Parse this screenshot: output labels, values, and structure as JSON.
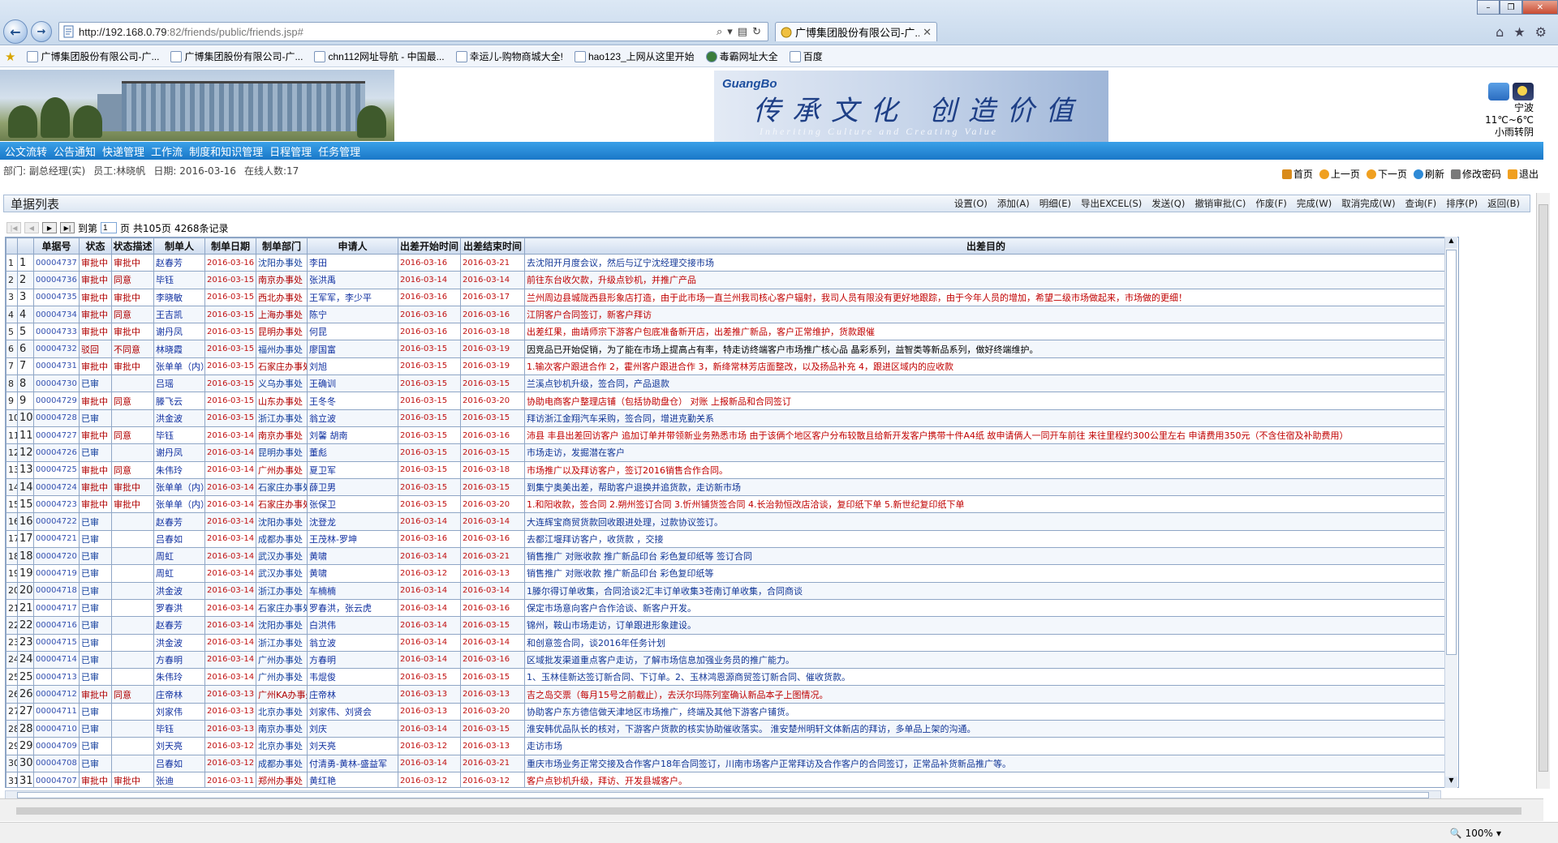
{
  "browser": {
    "url_main": "http://192.168.0.79",
    "url_rest": ":82/friends/public/friends.jsp#",
    "tab_title": "广博集团股份有限公司-广...",
    "favorites": [
      "广博集团股份有限公司-广...",
      "广博集团股份有限公司-广...",
      "chn112网址导航 - 中国最...",
      "幸运儿-购物商城大全!",
      "hao123_上网从这里开始",
      "毒霸网址大全",
      "百度"
    ],
    "zoom": "100%"
  },
  "banner": {
    "logo_brand": "GuangBo",
    "slogan": "传承文化 创造价值",
    "slogan_en": "Inheriting Culture and Creating Value",
    "weather_city": "宁波",
    "weather_temp": "11℃~6℃",
    "weather_desc": "小雨转阴"
  },
  "menu": [
    "公文流转",
    "公告通知",
    "快递管理",
    "工作流",
    "制度和知识管理",
    "日程管理",
    "任务管理"
  ],
  "info": {
    "dept_label": "部门:",
    "dept": "副总经理(实)",
    "staff_label": "员工:",
    "staff": "林晓帆",
    "date_label": "日期:",
    "date": "2016-03-16",
    "online_label": "在线人数:",
    "online": "17"
  },
  "topnav": [
    "首页",
    "上一页",
    "下一页",
    "刷新",
    "修改密码",
    "退出"
  ],
  "list": {
    "title": "单据列表",
    "actions": [
      "设置(O)",
      "添加(A)",
      "明细(E)",
      "导出EXCEL(S)",
      "发送(Q)",
      "撤销审批(C)",
      "作废(F)",
      "完成(W)",
      "取消完成(W)",
      "查询(F)",
      "排序(P)",
      "返回(B)"
    ],
    "pager": {
      "goto_label": "到第",
      "page_value": "1",
      "page_suffix": "页",
      "total": "共105页",
      "count": "4268条记录"
    },
    "headers": [
      "",
      "",
      "单据号",
      "状态",
      "状态描述",
      "制单人",
      "制单日期",
      "制单部门",
      "申请人",
      "出差开始时间",
      "出差结束时间",
      "出差目的"
    ],
    "rows": [
      [
        "1",
        "1",
        "00004737",
        "审批中",
        "审批中",
        "赵春芳",
        "2016-03-16",
        "沈阳办事处",
        "李田",
        "2016-03-16",
        "2016-03-21",
        "去沈阳开月度会议，然后与辽宁沈经理交接市场",
        "blue"
      ],
      [
        "2",
        "2",
        "00004736",
        "审批中",
        "同意",
        "毕钰",
        "2016-03-15",
        "南京办事处",
        "张洪禹",
        "2016-03-14",
        "2016-03-14",
        "前往东台收欠款，升级点钞机，并推广产品",
        "red"
      ],
      [
        "3",
        "3",
        "00004735",
        "审批中",
        "审批中",
        "李晓敏",
        "2016-03-15",
        "西北办事处",
        "王军军，李少平",
        "2016-03-16",
        "2016-03-17",
        "兰州周边县城陇西县形象店打造，由于此市场一直兰州我司核心客户辐射，我司人员有限没有更好地跟踪，由于今年人员的增加，希望二级市场做起来，市场做的更细！",
        "red"
      ],
      [
        "4",
        "4",
        "00004734",
        "审批中",
        "同意",
        "王吉凯",
        "2016-03-15",
        "上海办事处",
        "陈宁",
        "2016-03-16",
        "2016-03-16",
        "江阴客户合同签订，新客户拜访",
        "red"
      ],
      [
        "5",
        "5",
        "00004733",
        "审批中",
        "审批中",
        "谢丹凤",
        "2016-03-15",
        "昆明办事处",
        "何昆",
        "2016-03-16",
        "2016-03-18",
        "出差红果，曲靖师宗下游客户包底准备新开店，出差推广新品，客户正常维护，货款跟催",
        "red"
      ],
      [
        "6",
        "6",
        "00004732",
        "驳回",
        "不同意",
        "林晓霞",
        "2016-03-15",
        "福州办事处",
        "廖国富",
        "2016-03-15",
        "2016-03-19",
        "因竞品已开始促销，为了能在市场上提高占有率，特走访终端客户市场推广核心品 晶彩系列，益智类等新品系列，做好终端维护。",
        "black"
      ],
      [
        "7",
        "7",
        "00004731",
        "审批中",
        "审批中",
        "张单单（内）",
        "2016-03-15",
        "石家庄办事处",
        "刘旭",
        "2016-03-15",
        "2016-03-19",
        "1.输次客户跟进合作 2，霍州客户跟进合作 3，新绛常林芳店面整改，以及扬品补充 4，跟进区域内的应收款",
        "red"
      ],
      [
        "8",
        "8",
        "00004730",
        "已审",
        "",
        "吕瑶",
        "2016-03-15",
        "义乌办事处",
        "王确训",
        "2016-03-15",
        "2016-03-15",
        "兰溪点钞机升级，签合同，产品退款",
        "blue"
      ],
      [
        "9",
        "9",
        "00004729",
        "审批中",
        "同意",
        "滕飞云",
        "2016-03-15",
        "山东办事处",
        "王冬冬",
        "2016-03-15",
        "2016-03-20",
        "协助电商客户整理店铺（包括协助盘仓） 对账 上报新品和合同签订",
        "red"
      ],
      [
        "10",
        "10",
        "00004728",
        "已审",
        "",
        "洪金波",
        "2016-03-15",
        "浙江办事处",
        "翁立波",
        "2016-03-15",
        "2016-03-15",
        "拜访浙江金翔汽车采购，签合同，增进克勤关系",
        "blue"
      ],
      [
        "11",
        "11",
        "00004727",
        "审批中",
        "同意",
        "毕钰",
        "2016-03-14",
        "南京办事处",
        "刘馨 胡南",
        "2016-03-15",
        "2016-03-16",
        "沛县 丰县出差回访客户 追加订单并带领新业务熟悉市场 由于该俩个地区客户分布较散且给新开发客户携带十件A4纸 故申请俩人一同开车前往 来往里程约300公里左右 申请费用350元（不含住宿及补助费用）",
        "red"
      ],
      [
        "12",
        "12",
        "00004726",
        "已审",
        "",
        "谢丹凤",
        "2016-03-14",
        "昆明办事处",
        "董彪",
        "2016-03-15",
        "2016-03-15",
        "市场走访，发掘潜在客户",
        "blue"
      ],
      [
        "13",
        "13",
        "00004725",
        "审批中",
        "同意",
        "朱伟玲",
        "2016-03-14",
        "广州办事处",
        "夏卫军",
        "2016-03-15",
        "2016-03-18",
        "市场推广以及拜访客户，签订2016销售合作合同。",
        "red"
      ],
      [
        "14",
        "14",
        "00004724",
        "审批中",
        "审批中",
        "张单单（内）",
        "2016-03-14",
        "石家庄办事处",
        "薛卫男",
        "2016-03-15",
        "2016-03-15",
        "到集宁奥美出差，帮助客户退换并追货款，走访新市场",
        "blue"
      ],
      [
        "15",
        "15",
        "00004723",
        "审批中",
        "审批中",
        "张单单（内）",
        "2016-03-14",
        "石家庄办事处",
        "张保卫",
        "2016-03-15",
        "2016-03-20",
        "1.和阳收款，签合同 2.朔州签订合同 3.忻州铺货签合同 4.长治勃恒改店洽谈，复印纸下单 5.新世纪复印纸下单",
        "red"
      ],
      [
        "16",
        "16",
        "00004722",
        "已审",
        "",
        "赵春芳",
        "2016-03-14",
        "沈阳办事处",
        "沈登龙",
        "2016-03-14",
        "2016-03-14",
        "大连辉宝商贸货款回收跟进处理，过款协议签订。",
        "blue"
      ],
      [
        "17",
        "17",
        "00004721",
        "已审",
        "",
        "吕春如",
        "2016-03-14",
        "成都办事处",
        "王茂林-罗坤",
        "2016-03-16",
        "2016-03-16",
        "去都江堰拜访客户，收货款 ，交接",
        "blue"
      ],
      [
        "18",
        "18",
        "00004720",
        "已审",
        "",
        "周虹",
        "2016-03-14",
        "武汉办事处",
        "黄啸",
        "2016-03-14",
        "2016-03-21",
        "销售推广 对账收款 推广新品印台 彩色复印纸等 签订合同",
        "blue"
      ],
      [
        "19",
        "19",
        "00004719",
        "已审",
        "",
        "周虹",
        "2016-03-14",
        "武汉办事处",
        "黄啸",
        "2016-03-12",
        "2016-03-13",
        "销售推广 对账收款 推广新品印台 彩色复印纸等",
        "blue"
      ],
      [
        "20",
        "20",
        "00004718",
        "已审",
        "",
        "洪金波",
        "2016-03-14",
        "浙江办事处",
        "车楠楠",
        "2016-03-14",
        "2016-03-14",
        "1滕尔得订单收集，合同洽谈2汇丰订单收集3苍南订单收集，合同商谈",
        "blue"
      ],
      [
        "21",
        "21",
        "00004717",
        "已审",
        "",
        "罗春洪",
        "2016-03-14",
        "石家庄办事处",
        "罗春洪，张云虎",
        "2016-03-14",
        "2016-03-16",
        "保定市场意向客户合作洽谈、新客户开发。",
        "blue"
      ],
      [
        "22",
        "22",
        "00004716",
        "已审",
        "",
        "赵春芳",
        "2016-03-14",
        "沈阳办事处",
        "白洪伟",
        "2016-03-14",
        "2016-03-15",
        "锦州，鞍山市场走访，订单跟进形象建设。",
        "blue"
      ],
      [
        "23",
        "23",
        "00004715",
        "已审",
        "",
        "洪金波",
        "2016-03-14",
        "浙江办事处",
        "翁立波",
        "2016-03-14",
        "2016-03-14",
        "和创意签合同，谈2016年任务计划",
        "blue"
      ],
      [
        "24",
        "24",
        "00004714",
        "已审",
        "",
        "方春明",
        "2016-03-14",
        "广州办事处",
        "方春明",
        "2016-03-14",
        "2016-03-16",
        "区域批发渠道重点客户走访，了解市场信息加强业务员的推广能力。",
        "blue"
      ],
      [
        "25",
        "25",
        "00004713",
        "已审",
        "",
        "朱伟玲",
        "2016-03-14",
        "广州办事处",
        "韦焜俊",
        "2016-03-15",
        "2016-03-15",
        "1、玉林佳新达签订新合同、下订单。2、玉林鸿恩源商贸签订新合同、催收货款。",
        "blue"
      ],
      [
        "26",
        "26",
        "00004712",
        "审批中",
        "同意",
        "庄帝林",
        "2016-03-13",
        "广州KA办事处",
        "庄帝林",
        "2016-03-13",
        "2016-03-13",
        "吉之岛交票（每月15号之前截止），去沃尔玛陈列室确认新品本子上图情况。",
        "red"
      ],
      [
        "27",
        "27",
        "00004711",
        "已审",
        "",
        "刘家伟",
        "2016-03-13",
        "北京办事处",
        "刘家伟、刘贤会",
        "2016-03-13",
        "2016-03-20",
        "协助客户东方德信做天津地区市场推广，终端及其他下游客户铺货。",
        "blue"
      ],
      [
        "28",
        "28",
        "00004710",
        "已审",
        "",
        "毕钰",
        "2016-03-13",
        "南京办事处",
        "刘庆",
        "2016-03-14",
        "2016-03-15",
        "淮安韩优品队长的核对，下游客户货款的核实协助催收落实。 淮安楚州明轩文体新店的拜访，多单品上架的沟通。",
        "blue"
      ],
      [
        "29",
        "29",
        "00004709",
        "已审",
        "",
        "刘天亮",
        "2016-03-12",
        "北京办事处",
        "刘天亮",
        "2016-03-12",
        "2016-03-13",
        "走访市场",
        "blue"
      ],
      [
        "30",
        "30",
        "00004708",
        "已审",
        "",
        "吕春如",
        "2016-03-12",
        "成都办事处",
        "付清勇-黄林-盛益军",
        "2016-03-14",
        "2016-03-21",
        "重庆市场业务正常交接及合作客户18年合同签订，川南市场客户正常拜访及合作客户的合同签订，正常品补货新品推广等。",
        "blue"
      ],
      [
        "31",
        "31",
        "00004707",
        "审批中",
        "审批中",
        "张迪",
        "2016-03-11",
        "郑州办事处",
        "黄红艳",
        "2016-03-12",
        "2016-03-12",
        "客户点钞机升级，拜访、开发县城客户。",
        "red"
      ]
    ]
  }
}
